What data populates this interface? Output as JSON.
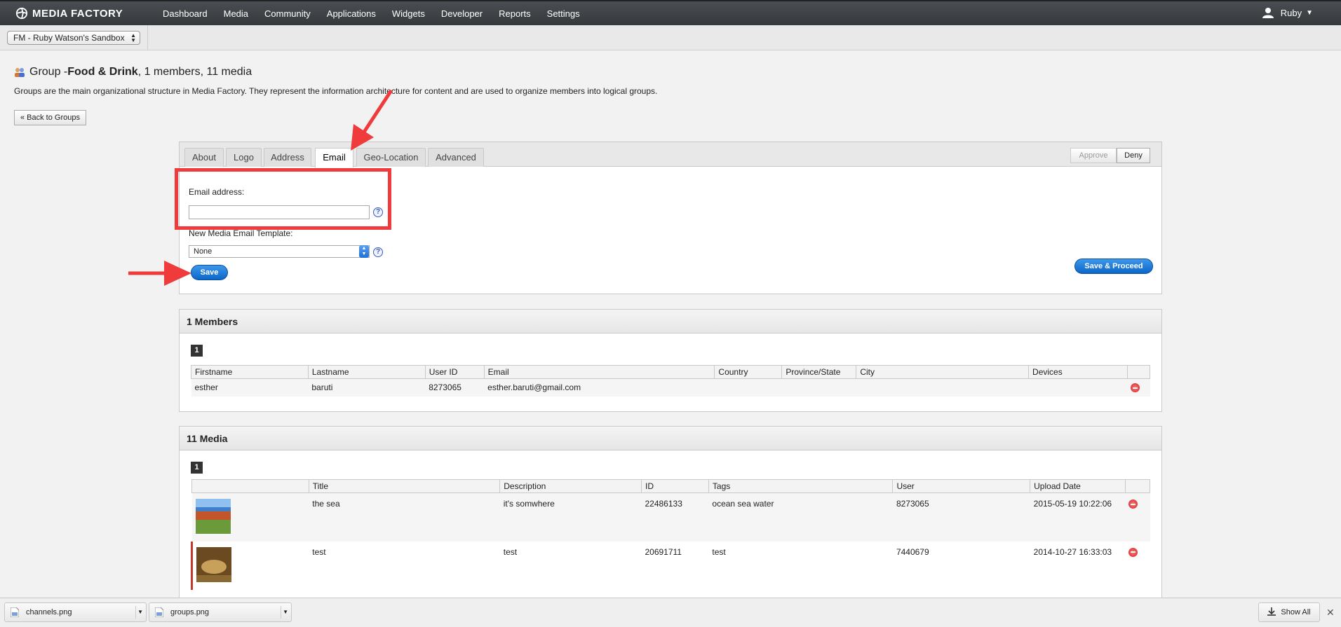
{
  "nav": {
    "brand": "MEDIA FACTORY",
    "items": [
      "Dashboard",
      "Media",
      "Community",
      "Applications",
      "Widgets",
      "Developer",
      "Reports",
      "Settings"
    ],
    "user": "Ruby"
  },
  "subbar": {
    "sandbox": "FM - Ruby Watson's Sandbox"
  },
  "page": {
    "title_prefix": "Group - ",
    "group_name": "Food & Drink",
    "title_suffix": ", 1 members, 11 media",
    "description": "Groups are the main organizational structure in Media Factory. They represent the information architecture for content and are used to organize members into logical groups.",
    "back_label": "« Back to Groups"
  },
  "tabs": [
    "About",
    "Logo",
    "Address",
    "Email",
    "Geo-Location",
    "Advanced"
  ],
  "panel": {
    "approve_label": "Approve",
    "deny_label": "Deny",
    "email_label": "Email address:",
    "email_value": "",
    "template_label": "New Media Email Template:",
    "template_value": "None",
    "help": "?",
    "save_label": "Save",
    "save_proceed_label": "Save & Proceed"
  },
  "members": {
    "header": "1 Members",
    "page": "1",
    "columns": [
      "Firstname",
      "Lastname",
      "User ID",
      "Email",
      "Country",
      "Province/State",
      "City",
      "Devices"
    ],
    "rows": [
      {
        "firstname": "esther",
        "lastname": "baruti",
        "user_id": "8273065",
        "email": "esther.baruti@gmail.com",
        "country": "",
        "province": "",
        "city": "",
        "devices": ""
      }
    ]
  },
  "media": {
    "header": "11 Media",
    "page": "1",
    "columns": [
      "",
      "Title",
      "Description",
      "ID",
      "Tags",
      "User",
      "Upload Date"
    ],
    "rows": [
      {
        "title": "the sea",
        "description": "it's somwhere",
        "id": "22486133",
        "tags": "ocean sea water",
        "user": "8273065",
        "date": "2015-05-19 10:22:06"
      },
      {
        "title": "test",
        "description": "test",
        "id": "20691711",
        "tags": "test",
        "user": "7440679",
        "date": "2014-10-27 16:33:03"
      }
    ]
  },
  "downloads": {
    "files": [
      "channels.png",
      "groups.png"
    ],
    "show_all": "Show All"
  },
  "colors": {
    "accent": "#0c66c8",
    "annotation": "#ef3b3b",
    "nav_bg": "#3e4246"
  }
}
